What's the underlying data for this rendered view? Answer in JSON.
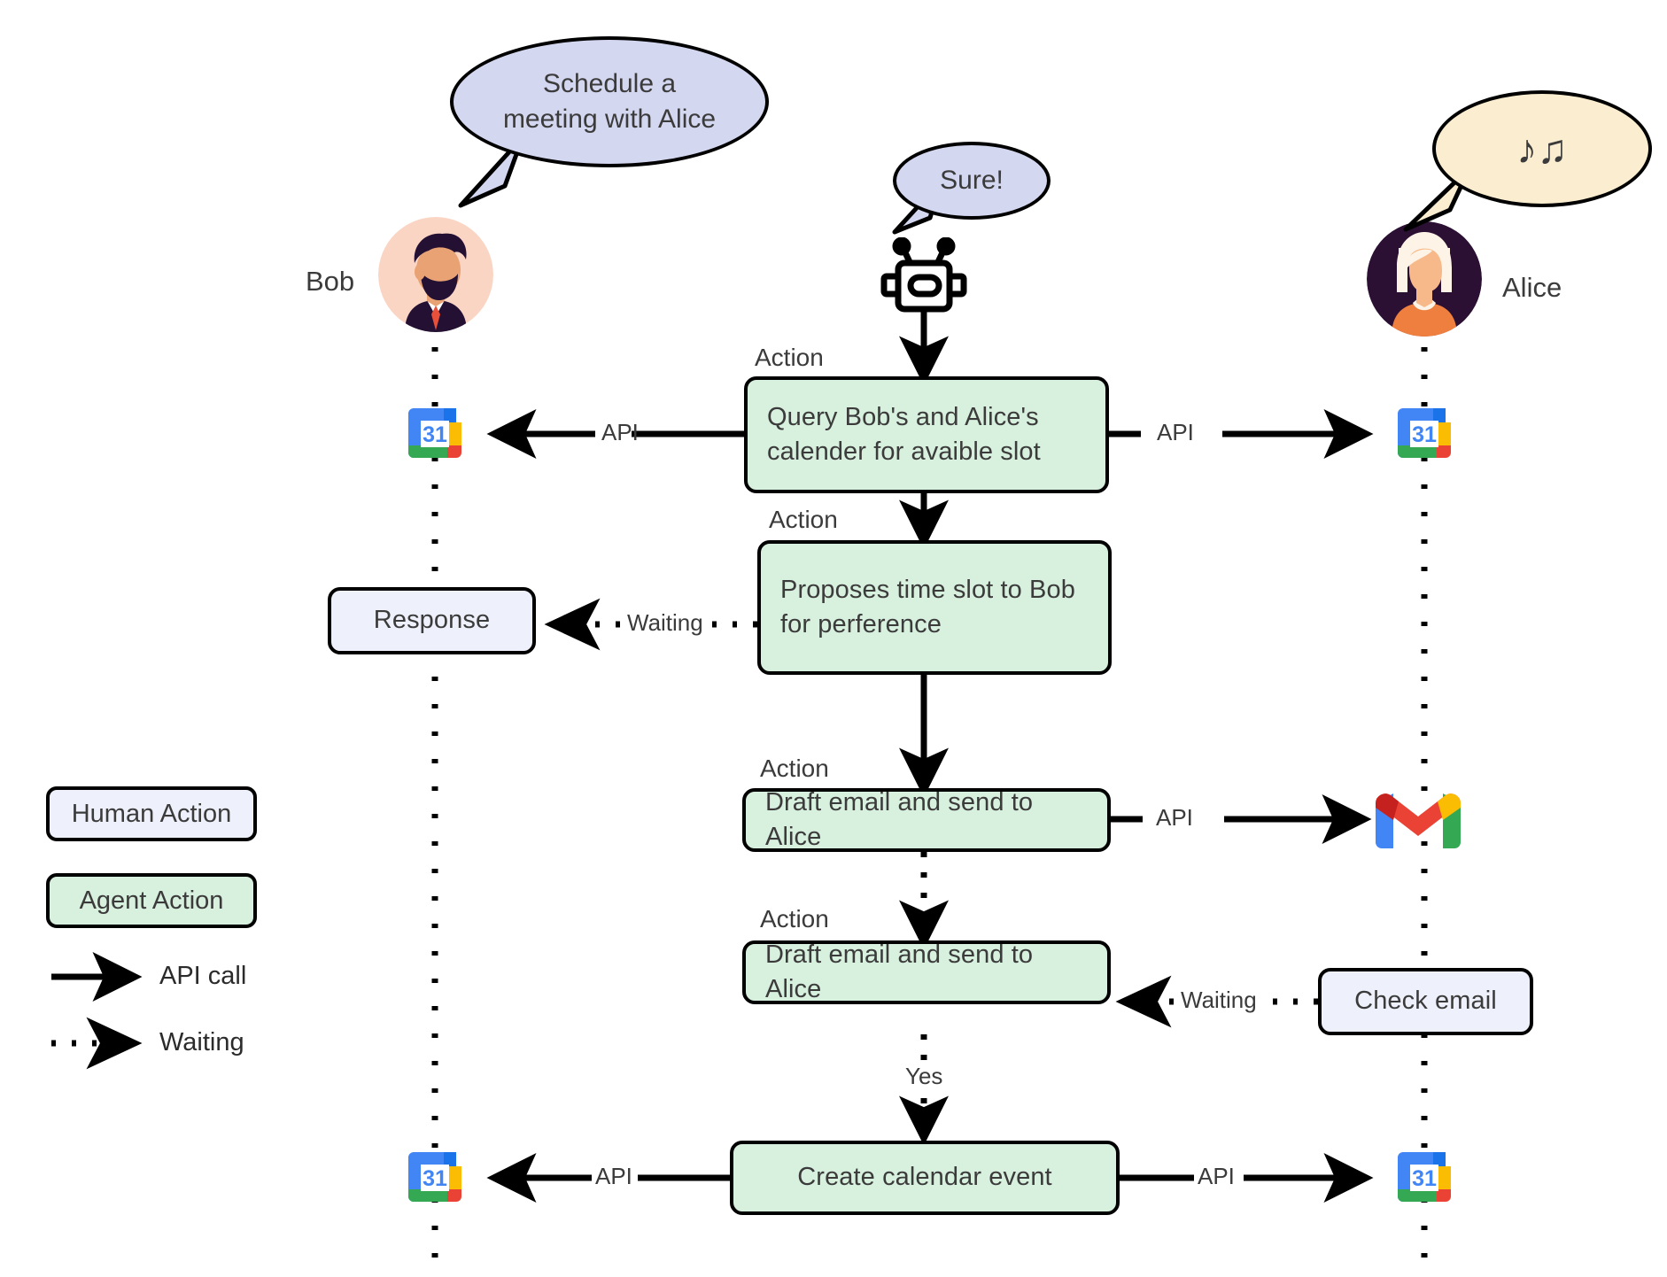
{
  "diagram": {
    "title": "Agent scheduling sequence diagram",
    "colors": {
      "agent_action_fill": "#d8f0de",
      "human_action_fill": "#eef1fb",
      "bob_bubble_fill": "#d4d7f0",
      "robot_bubble_fill": "#d4d7f0",
      "alice_bubble_fill": "#fbedcf",
      "stroke": "#000000",
      "bob_avatar_bg": "#fbd5c4",
      "alice_avatar_bg": "#2b1033"
    }
  },
  "actors": {
    "bob": {
      "name": "Bob",
      "avatar_icon": "bob-avatar",
      "bubble_text_line1": "Schedule a",
      "bubble_text_line2": "meeting with Alice"
    },
    "agent": {
      "icon": "robot-icon",
      "bubble_text": "Sure!"
    },
    "alice": {
      "name": "Alice",
      "avatar_icon": "alice-avatar",
      "bubble_text": "♪♫"
    }
  },
  "steps": [
    {
      "id": "query-calendars",
      "kind": "agent",
      "action_label": "Action",
      "text_line1": "Query Bob's and Alice's",
      "text_line2": "calender for avaible slot",
      "left_edge_label": "API",
      "right_edge_label": "API",
      "left_target_icon": "google-calendar-icon",
      "right_target_icon": "google-calendar-icon"
    },
    {
      "id": "propose-slot",
      "kind": "agent",
      "action_label": "Action",
      "text_line1": "Proposes time slot to Bob",
      "text_line2": "for perference",
      "left_edge_label": "Waiting",
      "left_target_label": "Response"
    },
    {
      "id": "draft-email-1",
      "kind": "agent",
      "action_label": "Action",
      "text_line1": "Draft email and send to Alice",
      "right_edge_label": "API",
      "right_target_icon": "gmail-icon"
    },
    {
      "id": "draft-email-2",
      "kind": "agent",
      "action_label": "Action",
      "text_line1": "Draft email and send to Alice",
      "right_edge_label": "Waiting",
      "right_target_label": "Check email",
      "below_edge_label": "Yes"
    },
    {
      "id": "create-event",
      "kind": "agent",
      "text_line1": "Create calendar event",
      "left_edge_label": "API",
      "right_edge_label": "API",
      "left_target_icon": "google-calendar-icon",
      "right_target_icon": "google-calendar-icon"
    }
  ],
  "legend": {
    "human_action": "Human Action",
    "agent_action": "Agent Action",
    "api_call": "API call",
    "waiting": "Waiting"
  }
}
